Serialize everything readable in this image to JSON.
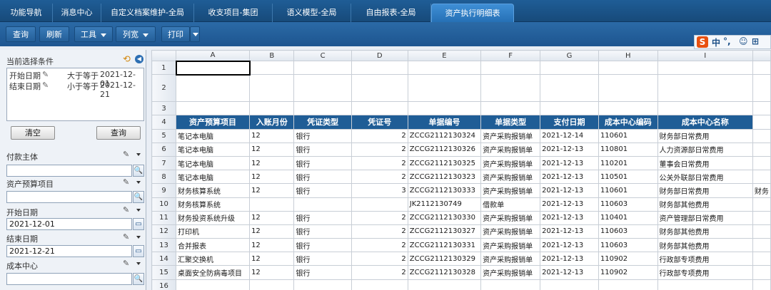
{
  "tabs": [
    "功能导航",
    "消息中心",
    "自定义档案维护-全局",
    "收支项目-集团",
    "语义模型-全局",
    "自由报表-全局",
    "资产执行明细表"
  ],
  "toolbar": {
    "query": "查询",
    "refresh": "刷新",
    "tools": "工具",
    "view": "列宽",
    "print": "打印"
  },
  "ime": {
    "logo": "S",
    "lang": "中",
    "punct": "°,",
    "emoji": "☺",
    "more": "⊞"
  },
  "left": {
    "cond_title": "当前选择条件",
    "conditions": [
      {
        "field": "开始日期",
        "op": "大于等于",
        "value": "2021-12-01"
      },
      {
        "field": "结束日期",
        "op": "小于等于",
        "value": "2021-12-21"
      }
    ],
    "clear": "清空",
    "query": "查询",
    "filters": [
      {
        "label": "付款主体",
        "value": ""
      },
      {
        "label": "资产预算项目",
        "value": ""
      },
      {
        "label": "开始日期",
        "value": "2021-12-01"
      },
      {
        "label": "结束日期",
        "value": "2021-12-21"
      },
      {
        "label": "成本中心",
        "value": ""
      }
    ]
  },
  "grid": {
    "columns": [
      "A",
      "B",
      "C",
      "D",
      "E",
      "F",
      "G",
      "H",
      "I"
    ],
    "headers": [
      "资产预算项目",
      "入账月份",
      "凭证类型",
      "凭证号",
      "单据编号",
      "单据类型",
      "支付日期",
      "成本中心编码",
      "成本中心名称"
    ],
    "rows": [
      [
        "笔记本电脑",
        "12",
        "银行",
        "2",
        "ZCCG2112130324",
        "资产采购报销单",
        "2021-12-14",
        "110601",
        "财务部日常费用"
      ],
      [
        "笔记本电脑",
        "12",
        "银行",
        "2",
        "ZCCG2112130326",
        "资产采购报销单",
        "2021-12-13",
        "110801",
        "人力资源部日常费用"
      ],
      [
        "笔记本电脑",
        "12",
        "银行",
        "2",
        "ZCCG2112130325",
        "资产采购报销单",
        "2021-12-13",
        "110201",
        "董事会日常费用"
      ],
      [
        "笔记本电脑",
        "12",
        "银行",
        "2",
        "ZCCG2112130323",
        "资产采购报销单",
        "2021-12-13",
        "110501",
        "公关外联部日常费用"
      ],
      [
        "财务核算系统",
        "12",
        "银行",
        "3",
        "ZCCG2112130333",
        "资产采购报销单",
        "2021-12-13",
        "110601",
        "财务部日常费用"
      ],
      [
        "财务核算系统",
        "",
        "",
        "",
        "JK2112130749",
        "借款单",
        "2021-12-13",
        "110603",
        "财务部其他费用"
      ],
      [
        "财务投资系统升级",
        "12",
        "银行",
        "2",
        "ZCCG2112130330",
        "资产采购报销单",
        "2021-12-13",
        "110401",
        "资产管理部日常费用"
      ],
      [
        "打印机",
        "12",
        "银行",
        "2",
        "ZCCG2112130327",
        "资产采购报销单",
        "2021-12-13",
        "110603",
        "财务部其他费用"
      ],
      [
        "合并报表",
        "12",
        "银行",
        "2",
        "ZCCG2112130331",
        "资产采购报销单",
        "2021-12-13",
        "110603",
        "财务部其他费用"
      ],
      [
        "汇聚交换机",
        "12",
        "银行",
        "2",
        "ZCCG2112130329",
        "资产采购报销单",
        "2021-12-13",
        "110902",
        "行政部专项费用"
      ],
      [
        "桌面安全防病毒项目",
        "12",
        "银行",
        "2",
        "ZCCG2112130328",
        "资产采购报销单",
        "2021-12-13",
        "110902",
        "行政部专项费用"
      ]
    ],
    "row_numbers": [
      "1",
      "2",
      "3",
      "4",
      "5",
      "6",
      "7",
      "8",
      "9",
      "10",
      "11",
      "12",
      "13",
      "14",
      "15",
      "16"
    ],
    "overflow_text": "财务"
  }
}
